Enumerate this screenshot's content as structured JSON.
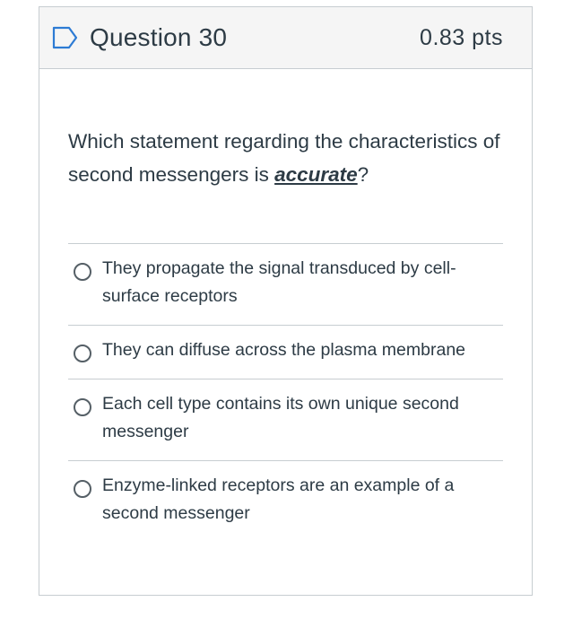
{
  "question": {
    "title": "Question 30",
    "points": "0.83 pts",
    "flag_icon": "flag-outline-icon",
    "text_before": "Which statement regarding the characteristics of second messengers is ",
    "text_emphasis": "accurate",
    "text_after": "?"
  },
  "answers": [
    {
      "label": "They propagate the signal transduced by cell-surface receptors",
      "selected": false
    },
    {
      "label": "They can diffuse across the plasma membrane",
      "selected": false
    },
    {
      "label": "Each cell type contains its own unique second messenger",
      "selected": false
    },
    {
      "label": "Enzyme-linked receptors are an example of a second messenger",
      "selected": false
    }
  ],
  "colors": {
    "flag": "#2d7bd4",
    "border": "#c7cdd1",
    "header_bg": "#f5f5f5",
    "text": "#2d3b45"
  }
}
